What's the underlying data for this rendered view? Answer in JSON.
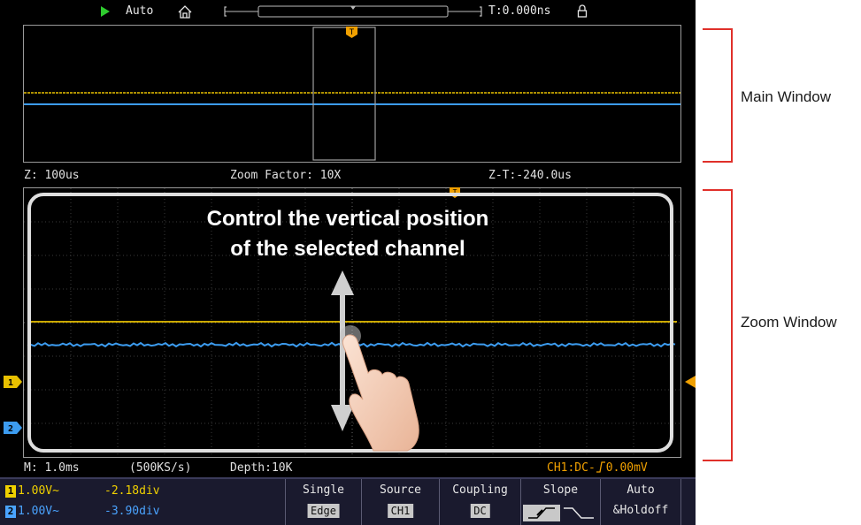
{
  "topbar": {
    "run_mode": "Auto",
    "time_offset": "T:0.000ns"
  },
  "main_window": {
    "zoom_timebase": "Z: 100us",
    "zoom_factor": "Zoom Factor: 10X",
    "zoom_offset": "Z-T:-240.0us"
  },
  "zoom_window": {
    "overlay_line1": "Control the vertical position",
    "overlay_line2": "of the selected channel",
    "ch1_marker": "1",
    "ch2_marker": "2"
  },
  "status": {
    "timebase": "M: 1.0ms",
    "sample_rate": "(500KS/s)",
    "depth": "Depth:10K",
    "trigger_info": "CH1:DC-",
    "trigger_level": "0.00mV"
  },
  "channels": [
    {
      "num": "1",
      "scale": "1.00V~",
      "offset": "-2.18div",
      "color": "#f0d000"
    },
    {
      "num": "2",
      "scale": "1.00V~",
      "offset": "-3.90div",
      "color": "#4aa3ff"
    }
  ],
  "menu": {
    "single_label": "Single",
    "single_value": "Edge",
    "source_label": "Source",
    "source_value": "CH1",
    "coupling_label": "Coupling",
    "coupling_value": "DC",
    "slope_label": "Slope",
    "holdoff_label1": "Auto",
    "holdoff_label2": "&Holdoff"
  },
  "annotations": {
    "main_window": "Main Window",
    "zoom_window": "Zoom Window"
  },
  "colors": {
    "ch1": "#e8c000",
    "ch2": "#3c9cf0",
    "trigger": "#f0a000",
    "run_indicator": "#2ecc2e"
  }
}
